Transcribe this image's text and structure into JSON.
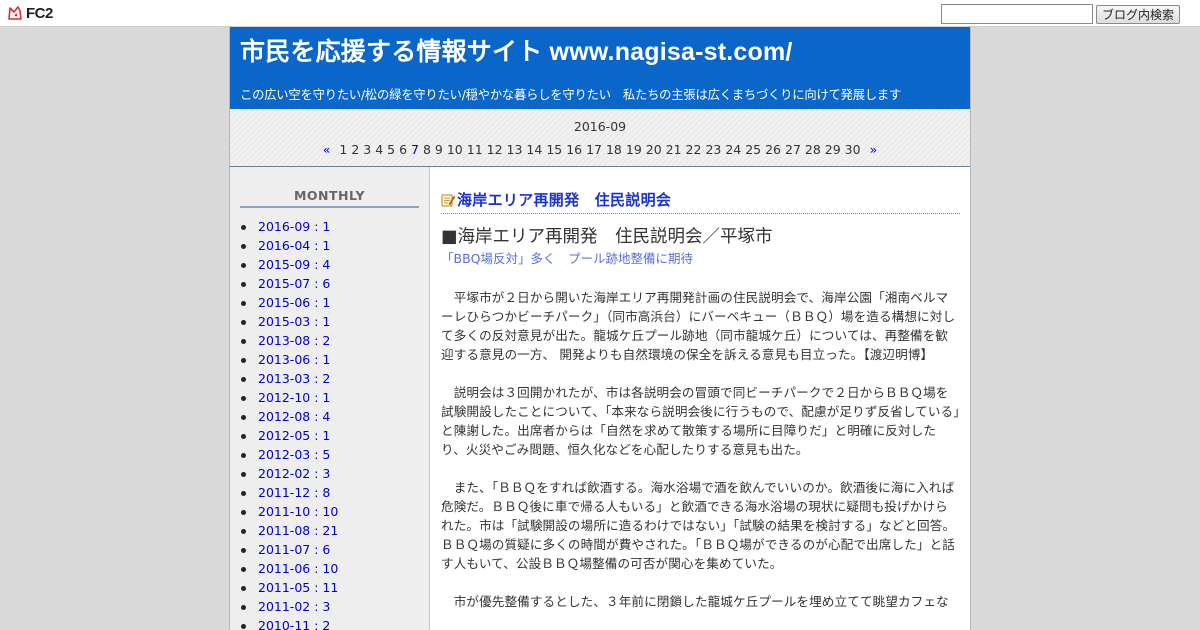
{
  "toolbar": {
    "logo_text": "FC2",
    "search_placeholder": "",
    "search_button": "ブログ内検索"
  },
  "header": {
    "title": "市民を応援する情報サイト www.nagisa-st.com/",
    "description": "この広い空を守りたい/松の緑を守りたい/穏やかな暮らしを守りたい　私たちの主張は広くまちづくりに向けて発展します"
  },
  "calendar": {
    "month": "2016-09",
    "prev": "«",
    "next": "»",
    "days": [
      "1",
      "2",
      "3",
      "4",
      "5",
      "6",
      "7",
      "8",
      "9",
      "10",
      "11",
      "12",
      "13",
      "14",
      "15",
      "16",
      "17",
      "18",
      "19",
      "20",
      "21",
      "22",
      "23",
      "24",
      "25",
      "26",
      "27",
      "28",
      "29",
      "30"
    ],
    "linked_days": [
      "7"
    ]
  },
  "sidebar": {
    "title": "MONTHLY",
    "months": [
      "2016-09 : 1",
      "2016-04 : 1",
      "2015-09 : 4",
      "2015-07 : 6",
      "2015-06 : 1",
      "2015-03 : 1",
      "2013-08 : 2",
      "2013-06 : 1",
      "2013-03 : 2",
      "2012-10 : 1",
      "2012-08 : 4",
      "2012-05 : 1",
      "2012-03 : 5",
      "2012-02 : 3",
      "2011-12 : 8",
      "2011-10 : 10",
      "2011-08 : 21",
      "2011-07 : 6",
      "2011-06 : 10",
      "2011-05 : 11",
      "2011-02 : 3",
      "2010-11 : 2"
    ]
  },
  "entry": {
    "title": "海岸エリア再開発　住民説明会",
    "headline": "■海岸エリア再開発　住民説明会／平塚市",
    "subheadline": "「BBQ場反対」多く　プール跡地整備に期待",
    "paragraphs": [
      "　平塚市が２日から開いた海岸エリア再開発計画の住民説明会で、海岸公園「湘南ベルマーレひらつかビーチパーク」（同市高浜台）にバーベキュー（ＢＢＱ）場を造る構想に対して多くの反対意見が出た。龍城ケ丘プール跡地（同市龍城ケ丘）については、再整備を歓迎する意見の一方、 開発よりも自然環境の保全を訴える意見も目立った。【渡辺明博】",
      "　説明会は３回開かれたが、市は各説明会の冒頭で同ビーチパークで２日からＢＢＱ場を試験開設したことについて、「本来なら説明会後に行うもので、配慮が足りず反省している」と陳謝した。出席者からは「自然を求めて散策する場所に目障りだ」と明確に反対したり、火災やごみ問題、恒久化などを心配したりする意見も出た。",
      "　また、「ＢＢＱをすれば飲酒する。海水浴場で酒を飲んでいいのか。飲酒後に海に入れば危険だ。ＢＢＱ後に車で帰る人もいる」と飲酒できる海水浴場の現状に疑問も投げかけられた。市は「試験開設の場所に造るわけではない」「試験の結果を検討する」などと回答。ＢＢＱ場の質疑に多くの時間が費やされた。「ＢＢＱ場ができるのが心配で出席した」と話す人もいて、公設ＢＢＱ場整備の可否が関心を集めていた。",
      "　市が優先整備するとした、３年前に閉鎖した龍城ケ丘プールを埋め立てて眺望カフェな"
    ]
  }
}
